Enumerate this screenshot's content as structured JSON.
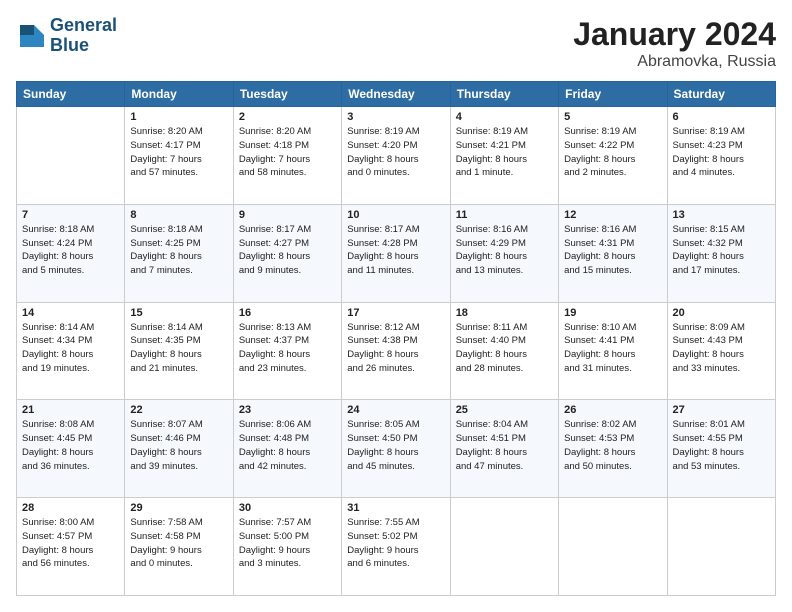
{
  "header": {
    "logo_line1": "General",
    "logo_line2": "Blue",
    "month": "January 2024",
    "location": "Abramovka, Russia"
  },
  "weekdays": [
    "Sunday",
    "Monday",
    "Tuesday",
    "Wednesday",
    "Thursday",
    "Friday",
    "Saturday"
  ],
  "weeks": [
    [
      {
        "day": "",
        "detail": ""
      },
      {
        "day": "1",
        "detail": "Sunrise: 8:20 AM\nSunset: 4:17 PM\nDaylight: 7 hours\nand 57 minutes."
      },
      {
        "day": "2",
        "detail": "Sunrise: 8:20 AM\nSunset: 4:18 PM\nDaylight: 7 hours\nand 58 minutes."
      },
      {
        "day": "3",
        "detail": "Sunrise: 8:19 AM\nSunset: 4:20 PM\nDaylight: 8 hours\nand 0 minutes."
      },
      {
        "day": "4",
        "detail": "Sunrise: 8:19 AM\nSunset: 4:21 PM\nDaylight: 8 hours\nand 1 minute."
      },
      {
        "day": "5",
        "detail": "Sunrise: 8:19 AM\nSunset: 4:22 PM\nDaylight: 8 hours\nand 2 minutes."
      },
      {
        "day": "6",
        "detail": "Sunrise: 8:19 AM\nSunset: 4:23 PM\nDaylight: 8 hours\nand 4 minutes."
      }
    ],
    [
      {
        "day": "7",
        "detail": "Sunrise: 8:18 AM\nSunset: 4:24 PM\nDaylight: 8 hours\nand 5 minutes."
      },
      {
        "day": "8",
        "detail": "Sunrise: 8:18 AM\nSunset: 4:25 PM\nDaylight: 8 hours\nand 7 minutes."
      },
      {
        "day": "9",
        "detail": "Sunrise: 8:17 AM\nSunset: 4:27 PM\nDaylight: 8 hours\nand 9 minutes."
      },
      {
        "day": "10",
        "detail": "Sunrise: 8:17 AM\nSunset: 4:28 PM\nDaylight: 8 hours\nand 11 minutes."
      },
      {
        "day": "11",
        "detail": "Sunrise: 8:16 AM\nSunset: 4:29 PM\nDaylight: 8 hours\nand 13 minutes."
      },
      {
        "day": "12",
        "detail": "Sunrise: 8:16 AM\nSunset: 4:31 PM\nDaylight: 8 hours\nand 15 minutes."
      },
      {
        "day": "13",
        "detail": "Sunrise: 8:15 AM\nSunset: 4:32 PM\nDaylight: 8 hours\nand 17 minutes."
      }
    ],
    [
      {
        "day": "14",
        "detail": "Sunrise: 8:14 AM\nSunset: 4:34 PM\nDaylight: 8 hours\nand 19 minutes."
      },
      {
        "day": "15",
        "detail": "Sunrise: 8:14 AM\nSunset: 4:35 PM\nDaylight: 8 hours\nand 21 minutes."
      },
      {
        "day": "16",
        "detail": "Sunrise: 8:13 AM\nSunset: 4:37 PM\nDaylight: 8 hours\nand 23 minutes."
      },
      {
        "day": "17",
        "detail": "Sunrise: 8:12 AM\nSunset: 4:38 PM\nDaylight: 8 hours\nand 26 minutes."
      },
      {
        "day": "18",
        "detail": "Sunrise: 8:11 AM\nSunset: 4:40 PM\nDaylight: 8 hours\nand 28 minutes."
      },
      {
        "day": "19",
        "detail": "Sunrise: 8:10 AM\nSunset: 4:41 PM\nDaylight: 8 hours\nand 31 minutes."
      },
      {
        "day": "20",
        "detail": "Sunrise: 8:09 AM\nSunset: 4:43 PM\nDaylight: 8 hours\nand 33 minutes."
      }
    ],
    [
      {
        "day": "21",
        "detail": "Sunrise: 8:08 AM\nSunset: 4:45 PM\nDaylight: 8 hours\nand 36 minutes."
      },
      {
        "day": "22",
        "detail": "Sunrise: 8:07 AM\nSunset: 4:46 PM\nDaylight: 8 hours\nand 39 minutes."
      },
      {
        "day": "23",
        "detail": "Sunrise: 8:06 AM\nSunset: 4:48 PM\nDaylight: 8 hours\nand 42 minutes."
      },
      {
        "day": "24",
        "detail": "Sunrise: 8:05 AM\nSunset: 4:50 PM\nDaylight: 8 hours\nand 45 minutes."
      },
      {
        "day": "25",
        "detail": "Sunrise: 8:04 AM\nSunset: 4:51 PM\nDaylight: 8 hours\nand 47 minutes."
      },
      {
        "day": "26",
        "detail": "Sunrise: 8:02 AM\nSunset: 4:53 PM\nDaylight: 8 hours\nand 50 minutes."
      },
      {
        "day": "27",
        "detail": "Sunrise: 8:01 AM\nSunset: 4:55 PM\nDaylight: 8 hours\nand 53 minutes."
      }
    ],
    [
      {
        "day": "28",
        "detail": "Sunrise: 8:00 AM\nSunset: 4:57 PM\nDaylight: 8 hours\nand 56 minutes."
      },
      {
        "day": "29",
        "detail": "Sunrise: 7:58 AM\nSunset: 4:58 PM\nDaylight: 9 hours\nand 0 minutes."
      },
      {
        "day": "30",
        "detail": "Sunrise: 7:57 AM\nSunset: 5:00 PM\nDaylight: 9 hours\nand 3 minutes."
      },
      {
        "day": "31",
        "detail": "Sunrise: 7:55 AM\nSunset: 5:02 PM\nDaylight: 9 hours\nand 6 minutes."
      },
      {
        "day": "",
        "detail": ""
      },
      {
        "day": "",
        "detail": ""
      },
      {
        "day": "",
        "detail": ""
      }
    ]
  ]
}
